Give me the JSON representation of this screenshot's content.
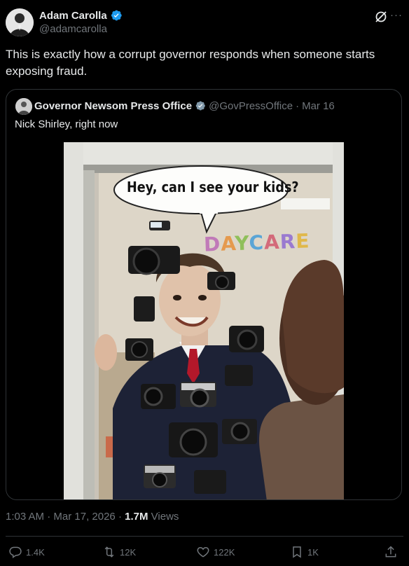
{
  "author": {
    "name": "Adam Carolla",
    "handle": "@adamcarolla"
  },
  "tweet": {
    "text": "This is exactly how a corrupt governor responds when someone starts exposing fraud."
  },
  "quoted_tweet": {
    "name": "Governor Newsom Press Office",
    "handle": "@GovPressOffice",
    "separator": "·",
    "date": "Mar 16",
    "text": "Nick Shirley, right now",
    "image": {
      "speech_bubble": "Hey, can I see your kids?",
      "sign": [
        "D",
        "A",
        "Y",
        "C",
        "A",
        "R",
        "E"
      ]
    }
  },
  "meta": {
    "time": "1:03 AM",
    "separator": "·",
    "date": "Mar 17, 2026",
    "views_count": "1.7M",
    "views_label": "Views"
  },
  "actions": {
    "replies": "1.4K",
    "retweets": "12K",
    "likes": "122K",
    "bookmarks": "1K"
  },
  "icons": {
    "verified": "verified-badge-icon",
    "grok": "grok-icon",
    "more": "more-icon",
    "reply": "reply-icon",
    "retweet": "retweet-icon",
    "like": "heart-icon",
    "bookmark": "bookmark-icon",
    "share": "share-icon"
  },
  "colors": {
    "background": "#000000",
    "text": "#e7e9ea",
    "secondary": "#71767b",
    "border": "#2f3336",
    "verified": "#1d9bf0"
  }
}
